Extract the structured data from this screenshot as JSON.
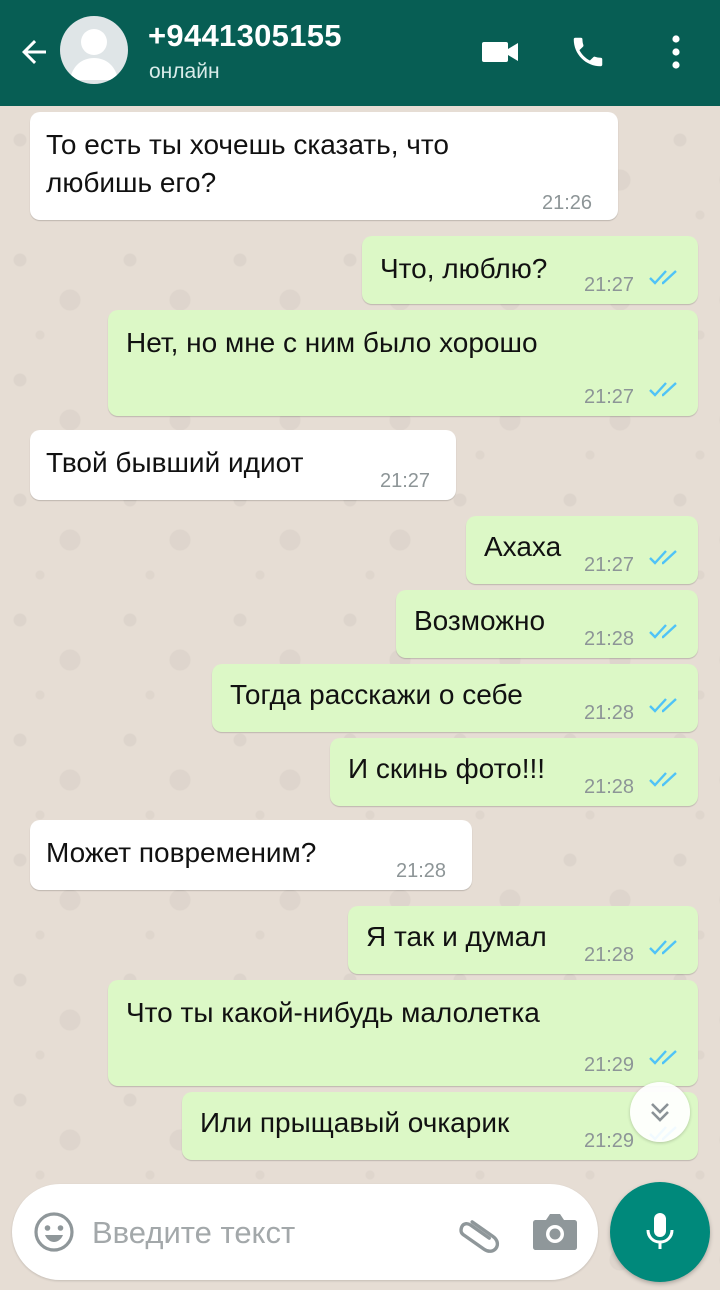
{
  "header": {
    "contact_name": "+9441305155",
    "status": "онлайн",
    "icons": [
      "back-arrow-icon",
      "avatar-placeholder-icon",
      "video-call-icon",
      "phone-call-icon",
      "more-vert-icon"
    ]
  },
  "messages": [
    {
      "direction": "in",
      "lines": [
        "То есть ты хочешь сказать, что",
        "любишь его?"
      ],
      "time": "21:26"
    },
    {
      "direction": "out",
      "lines": [
        "Что, люблю?"
      ],
      "time": "21:27",
      "read": true
    },
    {
      "direction": "out",
      "lines": [
        "Нет, но мне с ним было хорошо"
      ],
      "time": "21:27",
      "read": true
    },
    {
      "direction": "in",
      "lines": [
        "Твой бывший идиот"
      ],
      "time": "21:27"
    },
    {
      "direction": "out",
      "lines": [
        "Ахаха"
      ],
      "time": "21:27",
      "read": true
    },
    {
      "direction": "out",
      "lines": [
        "Возможно"
      ],
      "time": "21:28",
      "read": true
    },
    {
      "direction": "out",
      "lines": [
        "Тогда расскажи о себе"
      ],
      "time": "21:28",
      "read": true
    },
    {
      "direction": "out",
      "lines": [
        "И скинь фото!!!"
      ],
      "time": "21:28",
      "read": true
    },
    {
      "direction": "in",
      "lines": [
        "Может повременим?"
      ],
      "time": "21:28"
    },
    {
      "direction": "out",
      "lines": [
        "Я так и думал"
      ],
      "time": "21:28",
      "read": true
    },
    {
      "direction": "out",
      "lines": [
        "Что ты какой-нибудь малолетка"
      ],
      "time": "21:29",
      "read": true
    },
    {
      "direction": "out",
      "lines": [
        "Или прыщавый очкарик"
      ],
      "time": "21:29",
      "read": true
    }
  ],
  "composer": {
    "placeholder": "Введите текст",
    "icons": [
      "emoji-icon",
      "attach-icon",
      "camera-icon",
      "mic-icon"
    ]
  },
  "colors": {
    "header_bg": "#075e54",
    "incoming_bubble": "#ffffff",
    "outgoing_bubble": "#dcf8c6",
    "read_ticks": "#4fc3f7",
    "mic_button": "#00897b"
  }
}
